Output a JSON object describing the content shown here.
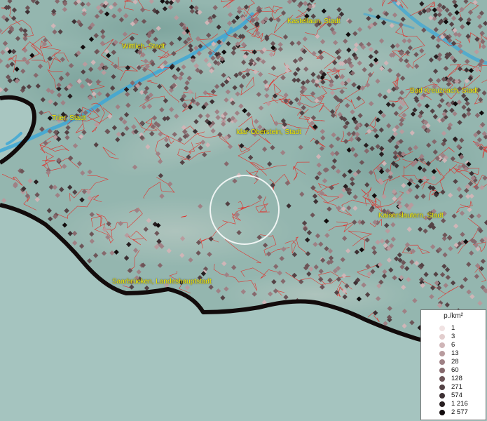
{
  "map": {
    "place_labels": [
      {
        "id": "kastellaun",
        "text": "Kastellaun, Stadt"
      },
      {
        "id": "wittlich",
        "text": "Wittlich, Stadt"
      },
      {
        "id": "bad-kreuznach",
        "text": "Bad Kreuznach, Stadt"
      },
      {
        "id": "trier",
        "text": "Trier, Stadt"
      },
      {
        "id": "idar-oberstein",
        "text": "Idar-Oberstein, Stadt"
      },
      {
        "id": "kaiserslautern",
        "text": "Kaiserslautern, Stadt"
      },
      {
        "id": "saarbruecken",
        "text": "Saarbrücken, Landeshauptstadt"
      }
    ],
    "colors": {
      "terrain": "#8fb3ad",
      "border_line": "#e8231e",
      "water": "#3da7d6",
      "frontier": "#1a0f0f",
      "label_text": "#f4f000"
    }
  },
  "legend": {
    "title": "p./km²",
    "entries": [
      {
        "label": "1",
        "color": "#f0e2e2"
      },
      {
        "label": "3",
        "color": "#e2cdcd"
      },
      {
        "label": "6",
        "color": "#cfb5b7"
      },
      {
        "label": "13",
        "color": "#b89b9e"
      },
      {
        "label": "28",
        "color": "#9f8185"
      },
      {
        "label": "60",
        "color": "#86696d"
      },
      {
        "label": "128",
        "color": "#6d5558"
      },
      {
        "label": "271",
        "color": "#544245"
      },
      {
        "label": "574",
        "color": "#3d3033"
      },
      {
        "label": "1 216",
        "color": "#271e20"
      },
      {
        "label": "2 577",
        "color": "#120c0d"
      }
    ]
  }
}
